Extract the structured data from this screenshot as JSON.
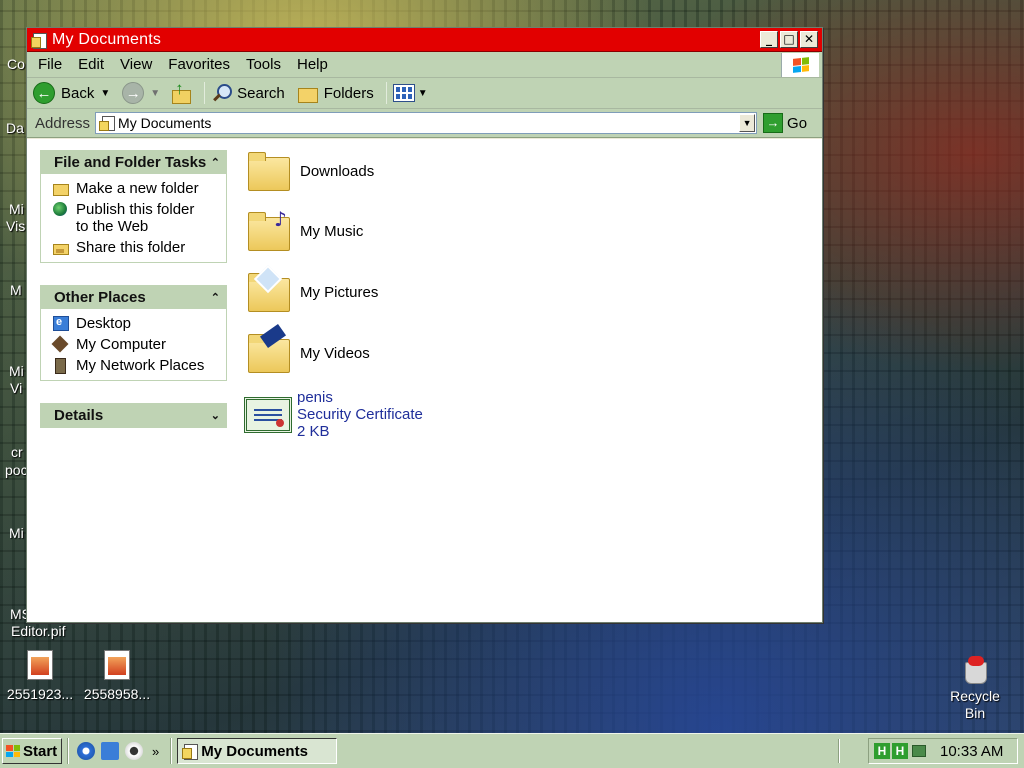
{
  "desktop": {
    "left_labels": [
      "Co",
      "Da",
      "Mi",
      "Vis",
      "M",
      "Mi",
      "Vi",
      "cr",
      "poc",
      "Mi",
      "MS",
      "Editor.pif"
    ],
    "icons": [
      {
        "label": "2551923..."
      },
      {
        "label": "2558958..."
      }
    ],
    "recycle_bin": {
      "line1": "Recycle",
      "line2": "Bin"
    }
  },
  "window": {
    "title": "My Documents",
    "controls": {
      "minimize": "_",
      "maximize": "□",
      "close": "✕"
    },
    "menu": [
      "File",
      "Edit",
      "View",
      "Favorites",
      "Tools",
      "Help"
    ],
    "toolbar": {
      "back": "Back",
      "search": "Search",
      "folders": "Folders"
    },
    "address": {
      "label": "Address",
      "value": "My Documents",
      "go": "Go"
    },
    "task_pane": {
      "file_tasks": {
        "title": "File and Folder Tasks",
        "items": [
          "Make a new folder",
          "Publish this folder to the Web",
          "Share this folder"
        ]
      },
      "other_places": {
        "title": "Other Places",
        "items": [
          "Desktop",
          "My Computer",
          "My Network Places"
        ]
      },
      "details": {
        "title": "Details"
      }
    },
    "items": [
      {
        "name": "Downloads",
        "icon": "folder-icon"
      },
      {
        "name": "My Music",
        "icon": "music-folder-icon"
      },
      {
        "name": "My Pictures",
        "icon": "pictures-folder-icon"
      },
      {
        "name": "My Videos",
        "icon": "videos-folder-icon"
      }
    ],
    "certificate": {
      "name": "penis",
      "type": "Security Certificate",
      "size": "2 KB"
    }
  },
  "taskbar": {
    "start": "Start",
    "more": "»",
    "active_window": "My Documents",
    "tray_icons": [
      "H",
      "H"
    ],
    "clock": "10:33 AM"
  }
}
